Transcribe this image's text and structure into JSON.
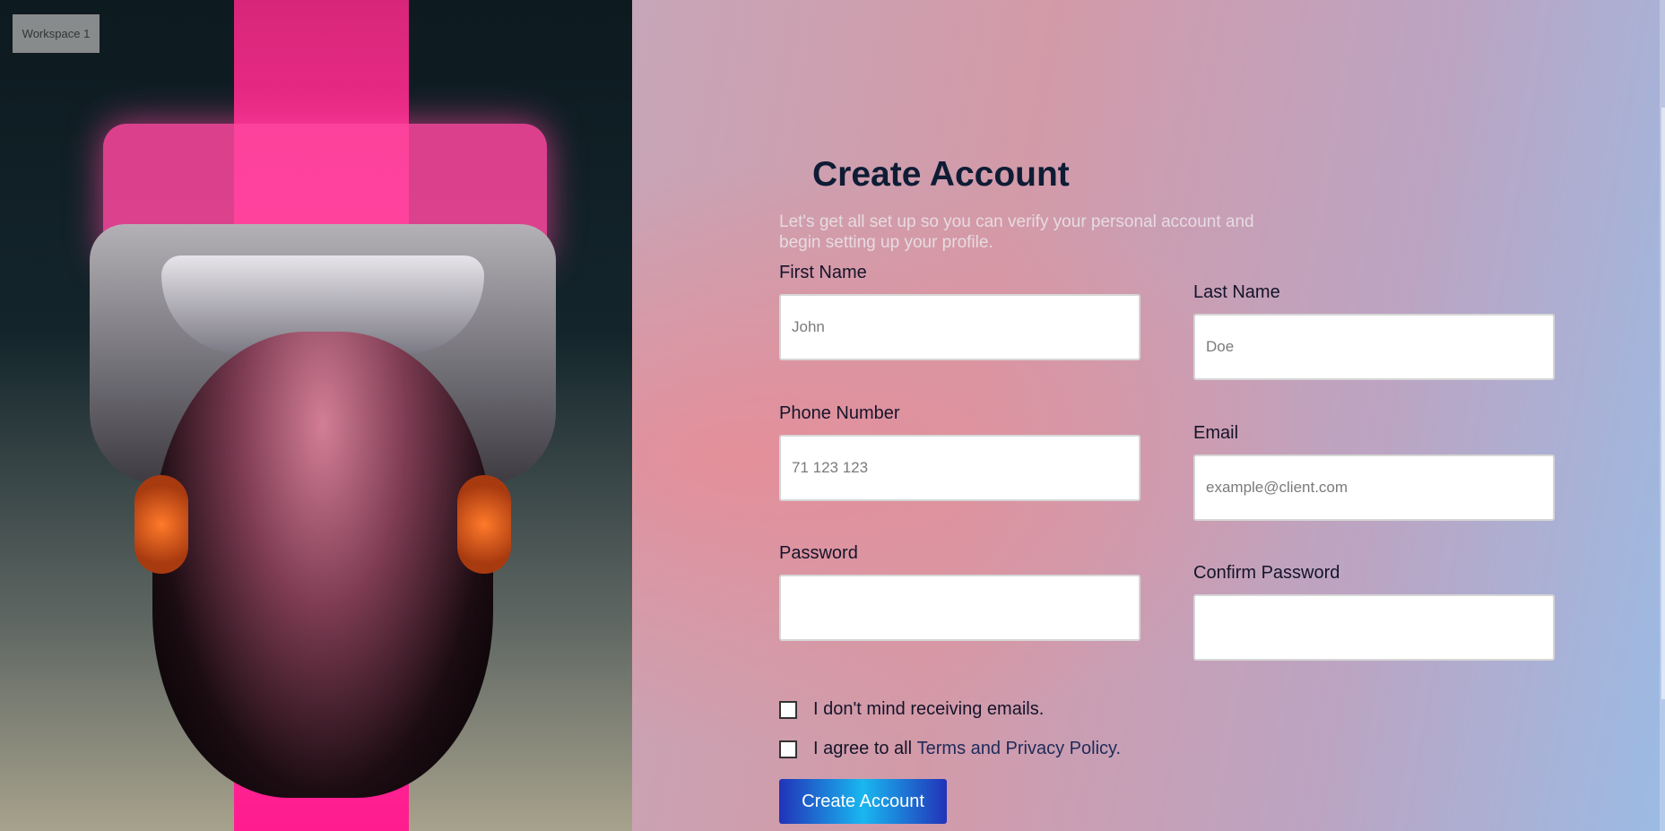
{
  "workspace": {
    "label": "Workspace 1"
  },
  "form": {
    "title": "Create Account",
    "subtitle": "Let's get all set up so you can verify your personal account and begin setting up your profile.",
    "first_name": {
      "label": "First Name",
      "placeholder": "John",
      "value": ""
    },
    "last_name": {
      "label": "Last Name",
      "placeholder": "Doe",
      "value": ""
    },
    "phone": {
      "label": "Phone Number",
      "placeholder": "71 123 123",
      "value": ""
    },
    "email": {
      "label": "Email",
      "placeholder": "example@client.com",
      "value": ""
    },
    "password": {
      "label": "Password",
      "placeholder": "",
      "value": ""
    },
    "confirm_password": {
      "label": "Confirm Password",
      "placeholder": "",
      "value": ""
    },
    "emails_checkbox": {
      "label": "I don't mind receiving emails.",
      "checked": false
    },
    "terms_checkbox": {
      "label_prefix": "I agree to all ",
      "link_text": "Terms and Privacy Policy.",
      "checked": false
    },
    "submit_label": "Create Account"
  },
  "colors": {
    "title": "#0e1c35",
    "button_start": "#2133b8",
    "button_mid": "#19b7f0",
    "accent_pink": "#ff2f93"
  },
  "icons": [
    "checkbox-icon"
  ]
}
